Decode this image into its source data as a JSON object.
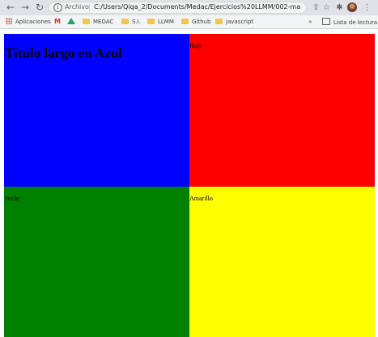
{
  "browser": {
    "back_icon": "arrow-left-icon",
    "forward_icon": "arrow-right-icon",
    "reload_icon": "reload-icon",
    "info_icon": "info-icon",
    "scheme_label": "Archivo",
    "url": "C:/Users/Qiqa_2/Documents/Medac/Ejercicios%20LLMM/002-maquo...",
    "share_icon": "share-icon",
    "star_icon": "star-icon",
    "extensions_icon": "puzzle-icon",
    "menu_icon": "kebab-menu-icon"
  },
  "bookmarks": {
    "apps": "Aplicaciones",
    "items": [
      "MEDAC",
      "S.I.",
      "LLMM",
      "Github",
      "javascript"
    ],
    "overflow": "»",
    "reading_list": "Lista de lectura"
  },
  "page": {
    "azul_title": "Titulo largo en Azul",
    "rojo_label": "Rojo",
    "verde_label": "Verde",
    "amarillo_label": "Amarillo",
    "colors": {
      "azul": "#0000ff",
      "rojo": "#ff0000",
      "verde": "#008000",
      "amarillo": "#ffff00"
    }
  }
}
